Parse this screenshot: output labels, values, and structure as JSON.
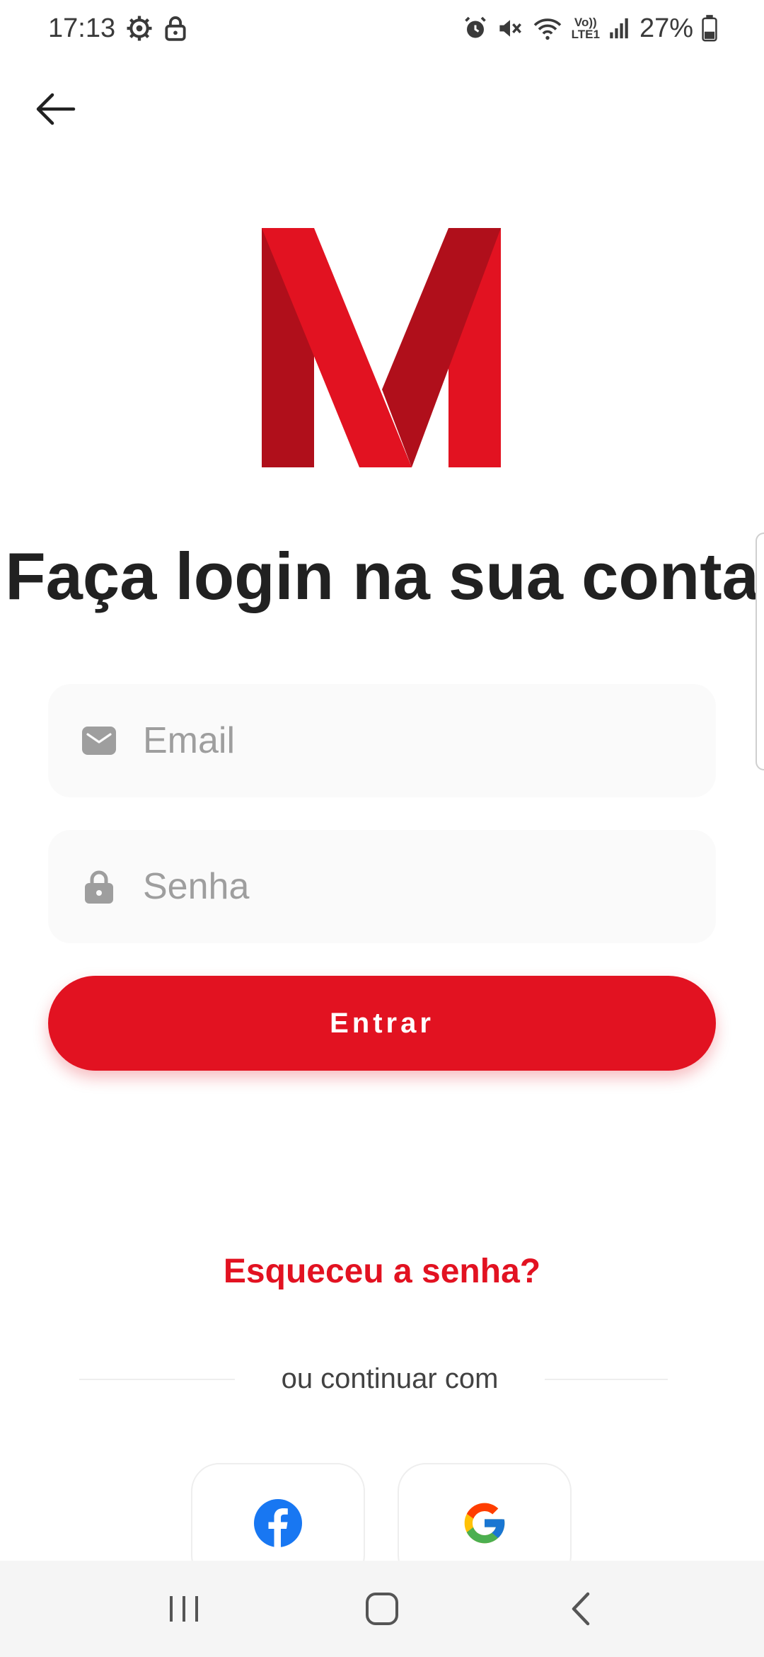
{
  "status_bar": {
    "time": "17:13",
    "left_icons": [
      "gear-icon",
      "lock-icon"
    ],
    "right_icons": [
      "alarm-icon",
      "mute-icon",
      "wifi-icon",
      "volte-lte-icon",
      "signal-icon",
      "battery-icon"
    ],
    "network_label_top": "Vo))",
    "network_label_bottom": "LTE1",
    "battery_percent": "27%"
  },
  "header": {
    "back_icon": "arrow-left-icon"
  },
  "logo": {
    "letter": "M",
    "colors": {
      "primary": "#e21221",
      "shade": "#b00f1b"
    }
  },
  "title": "Faça login na sua conta",
  "form": {
    "email": {
      "placeholder": "Email",
      "value": "",
      "icon": "mail-icon"
    },
    "password": {
      "placeholder": "Senha",
      "value": "",
      "icon": "lock-icon"
    },
    "submit_label": "Entrar"
  },
  "forgot_password": "Esqueceu a senha?",
  "divider_text": "ou continuar com",
  "social": [
    {
      "name": "facebook",
      "icon": "facebook-icon"
    },
    {
      "name": "google",
      "icon": "google-icon"
    }
  ],
  "nav_bar": {
    "buttons": [
      "recents-icon",
      "home-icon",
      "back-icon"
    ]
  },
  "colors": {
    "accent": "#e21221",
    "field_bg": "#fafafa",
    "placeholder": "#9e9e9e",
    "text": "#212121"
  }
}
